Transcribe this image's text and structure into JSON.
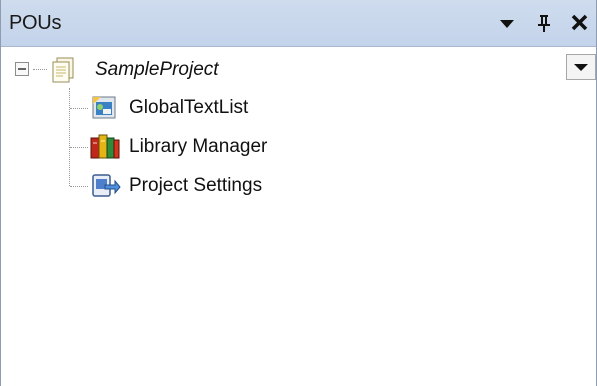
{
  "panel": {
    "title": "POUs",
    "buttons": {
      "dropdown_icon": "triangle-down",
      "pin_icon": "pushpin",
      "close_icon": "close-x"
    }
  },
  "tree": {
    "root": {
      "label": "SampleProject",
      "expanded": true,
      "icon": "project-document-icon"
    },
    "children": [
      {
        "label": "GlobalTextList",
        "icon": "text-list-icon"
      },
      {
        "label": "Library Manager",
        "icon": "library-books-icon"
      },
      {
        "label": "Project Settings",
        "icon": "settings-arrow-icon"
      }
    ]
  },
  "colors": {
    "titlebar": "#c7d6ec",
    "text": "#111111"
  }
}
